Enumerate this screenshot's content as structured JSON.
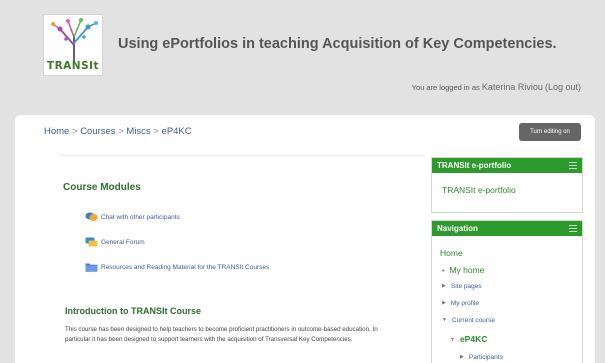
{
  "header": {
    "logo_text": "TRANSIt",
    "site_title": "Using ePortfolios in teaching Acquisition of Key Competencies.",
    "login_prefix": "You are logged in as",
    "user_name": "Katerina Riviou",
    "logout_label": "(Log out)"
  },
  "breadcrumb": {
    "items": [
      "Home",
      "Courses",
      "Miscs",
      "eP4KC"
    ],
    "separator": ">"
  },
  "edit_button_label": "Turn editing on",
  "course": {
    "modules_title": "Course Modules",
    "modules": [
      {
        "icon": "chat-icon",
        "label": "Chat with other participants"
      },
      {
        "icon": "forum-icon",
        "label": "General Forum"
      },
      {
        "icon": "folder-icon",
        "label": "Resources and Reading Material for the TRANSIt Courses"
      }
    ],
    "intro_title": "Introduction to TRANSIt Course",
    "intro_text": "This course has been designed to help teachers to become proficient practitioners in outcome-based education.  In particular it has been designed to support learners with the acquisition of Transversal Key Competencies."
  },
  "blocks": {
    "portfolio": {
      "title": "TRANSIt e-portfolio",
      "link": "TRANSIt e-portfolio"
    },
    "navigation": {
      "title": "Navigation",
      "home": "Home",
      "my_home": "My home",
      "site_pages": "Site pages",
      "my_profile": "My profile",
      "current_course": "Current course",
      "course_short": "eP4KC",
      "participants": "Participants"
    }
  },
  "colors": {
    "brand_green": "#2c9a2c",
    "title_green": "#2f6e2f",
    "link_blue": "#3d5e9a",
    "header_bg": "#e2e2e2",
    "button_bg": "#666666"
  }
}
